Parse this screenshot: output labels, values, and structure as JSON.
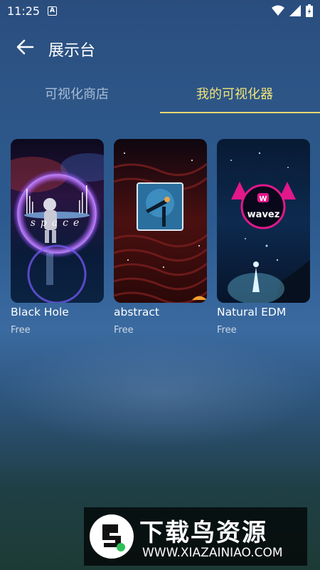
{
  "status": {
    "time": "11:25",
    "a_badge": "A"
  },
  "appbar": {
    "title": "展示台"
  },
  "tabs": [
    {
      "label": "可视化商店",
      "active": false
    },
    {
      "label": "我的可视化器",
      "active": true
    }
  ],
  "cards": [
    {
      "name": "Black Hole",
      "price": "Free",
      "overlay_text": "space"
    },
    {
      "name": "abstract",
      "price": "Free"
    },
    {
      "name": "Natural EDM",
      "price": "Free",
      "logo_text": "wavez"
    }
  ],
  "watermark": {
    "title": "下载鸟资源",
    "url": "WWW.XIAZAINIAO.COM"
  },
  "colors": {
    "active_tab": "#f0e27a",
    "inactive_tab": "#a9bcd6"
  }
}
